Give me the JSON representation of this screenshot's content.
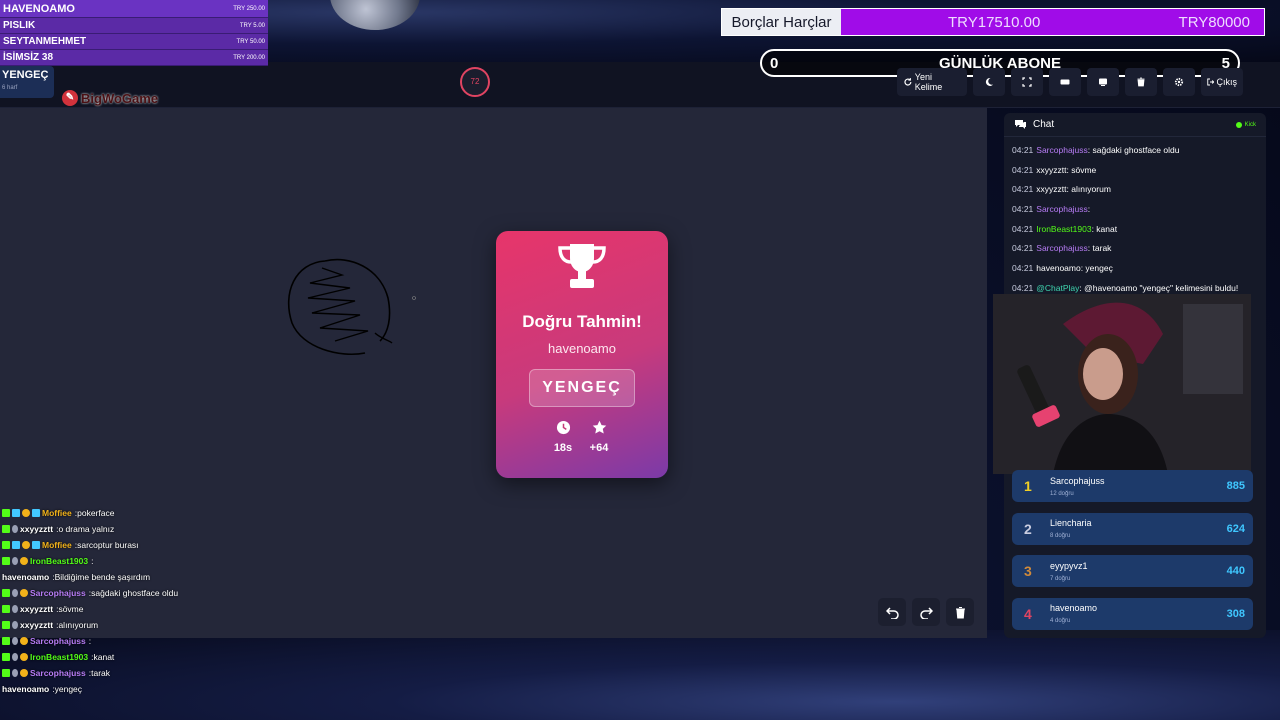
{
  "donations": [
    {
      "name": "HAVENOAMO",
      "amount": "TRY 250.00"
    },
    {
      "name": "PISLIK",
      "amount": "TRY 5.00"
    },
    {
      "name": "SEYTANMEHMET",
      "amount": "TRY 50.00"
    },
    {
      "name": "İSİMSİZ 38",
      "amount": "TRY 200.00"
    }
  ],
  "word_box": {
    "word": "YENGEÇ",
    "hint": "6 harf"
  },
  "logo": {
    "text": "BigWoGame"
  },
  "timer": {
    "value": "72"
  },
  "toolbar": {
    "new_word": "Yeni Kelime",
    "exit": "Çıkış"
  },
  "debts": {
    "label": "Borçlar Harçlar",
    "current": "TRY17510.00",
    "goal": "TRY80000",
    "progress": 0.219
  },
  "subs": {
    "title": "GÜNLÜK ABONE",
    "left": "0",
    "right": "5"
  },
  "card": {
    "title": "Doğru Tahmin!",
    "user": "havenoamo",
    "word": "YENGEÇ",
    "time": "18s",
    "points": "+64"
  },
  "overlay_chat": [
    {
      "user": "Moffiee",
      "color": "#f2b21a",
      "msg": "pokerface",
      "badges": [
        "k",
        "g",
        "o",
        "g"
      ]
    },
    {
      "user": "xxyyzztt",
      "color": "#ffffff",
      "msg": "o drama yalnız",
      "badges": [
        "k",
        "s"
      ]
    },
    {
      "user": "Moffiee",
      "color": "#f2b21a",
      "msg": "sarcoptur burası",
      "badges": [
        "k",
        "g",
        "o",
        "g"
      ]
    },
    {
      "user": "IronBeast1903",
      "color": "#53fc18",
      "msg": "",
      "badges": [
        "k",
        "s",
        "o"
      ]
    },
    {
      "user": "havenoamo",
      "color": "#ffffff",
      "msg": "Bildiğime bende şaşırdım",
      "badges": []
    },
    {
      "user": "Sarcophajuss",
      "color": "#b77cf5",
      "msg": "sağdaki ghostface oldu",
      "badges": [
        "k",
        "s",
        "o"
      ]
    },
    {
      "user": "xxyyzztt",
      "color": "#ffffff",
      "msg": "sövme",
      "badges": [
        "k",
        "s"
      ]
    },
    {
      "user": "xxyyzztt",
      "color": "#ffffff",
      "msg": "alınıyorum",
      "badges": [
        "k",
        "s"
      ]
    },
    {
      "user": "Sarcophajuss",
      "color": "#b77cf5",
      "msg": "",
      "badges": [
        "k",
        "s",
        "o"
      ]
    },
    {
      "user": "IronBeast1903",
      "color": "#53fc18",
      "msg": "kanat",
      "badges": [
        "k",
        "s",
        "o"
      ]
    },
    {
      "user": "Sarcophajuss",
      "color": "#b77cf5",
      "msg": "tarak",
      "badges": [
        "k",
        "s",
        "o"
      ]
    },
    {
      "user": "havenoamo",
      "color": "#ffffff",
      "msg": "yengeç",
      "badges": []
    }
  ],
  "side_chat": {
    "title": "Chat",
    "platform": "Kick",
    "messages": [
      {
        "time": "04:21",
        "user": "Sarcophajuss",
        "color": "#b77cf5",
        "msg": ": sağdaki ghostface oldu"
      },
      {
        "time": "04:21",
        "user": "xxyyzztt",
        "color": "#ffffff",
        "msg": ": sövme"
      },
      {
        "time": "04:21",
        "user": "xxyyzztt",
        "color": "#ffffff",
        "msg": ": alınıyorum"
      },
      {
        "time": "04:21",
        "user": "Sarcophajuss",
        "color": "#b77cf5",
        "msg": ":"
      },
      {
        "time": "04:21",
        "user": "IronBeast1903",
        "color": "#53fc18",
        "msg": ": kanat"
      },
      {
        "time": "04:21",
        "user": "Sarcophajuss",
        "color": "#b77cf5",
        "msg": ": tarak"
      },
      {
        "time": "04:21",
        "user": "havenoamo",
        "color": "#ffffff",
        "msg": ": yengeç"
      },
      {
        "time": "04:21",
        "user": "@ChatPlay",
        "color": "#3fd6b0",
        "msg": ": @havenoamo \"yengeç\" kelimesini buldu!"
      }
    ]
  },
  "leaderboard": [
    {
      "rank": "1",
      "rank_color": "#f2d024",
      "name": "Sarcophajuss",
      "sub": "12 doğru",
      "score": "885"
    },
    {
      "rank": "2",
      "rank_color": "#c9cde0",
      "name": "Liencharia",
      "sub": "8 doğru",
      "score": "624"
    },
    {
      "rank": "3",
      "rank_color": "#d08a3a",
      "name": "eyypyvz1",
      "sub": "7 doğru",
      "score": "440"
    },
    {
      "rank": "4",
      "rank_color": "#e04462",
      "name": "havenoamo",
      "sub": "4 doğru",
      "score": "308"
    }
  ]
}
